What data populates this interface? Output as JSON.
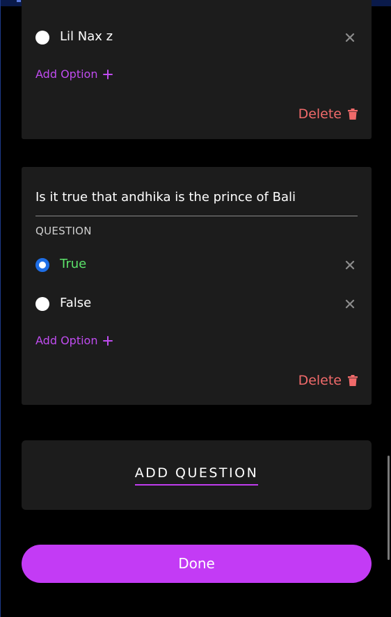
{
  "card_1": {
    "option_label": "Lil Nax z",
    "add_option_label": "Add Option",
    "delete_label": "Delete"
  },
  "question_card": {
    "question_text": "Is it true that andhika is the prince of Bali",
    "caption": "QUESTION",
    "options": [
      {
        "label": "True",
        "selected": true
      },
      {
        "label": "False",
        "selected": false
      }
    ],
    "add_option_label": "Add Option",
    "delete_label": "Delete"
  },
  "add_question_label": "ADD QUESTION",
  "done_label": "Done",
  "icons": {
    "remove": "close-icon",
    "add": "plus-icon",
    "delete": "trash-icon"
  },
  "colors": {
    "background": "#000000",
    "card": "#1c1c1c",
    "accent_purple": "#c33bf5",
    "delete_red": "#f06a6a",
    "correct_green": "#5ce36a",
    "radio_selected": "#1e6ee6"
  }
}
